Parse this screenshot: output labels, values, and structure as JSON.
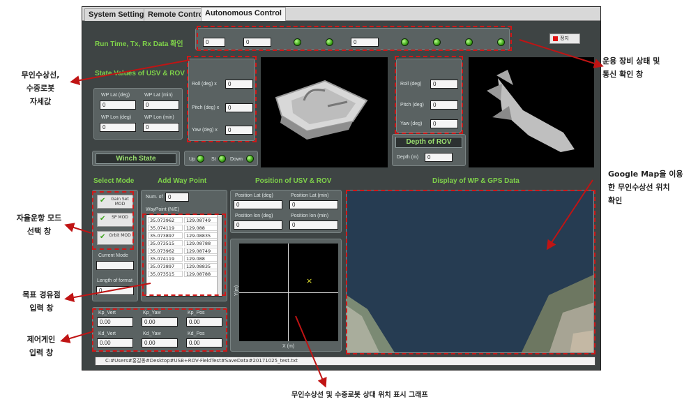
{
  "tabs": [
    "System Setting",
    "Remote Control",
    "Autonomous Control"
  ],
  "header": {
    "run_time_title": "Run Time, Tx, Rx Data 확인",
    "stop_label": "정지",
    "field_values": [
      "0",
      "0",
      "0"
    ]
  },
  "state": {
    "title": "State Values of USV & ROV",
    "usv_fields": [
      {
        "label": "WP Lat (deg)",
        "value": "0"
      },
      {
        "label": "WP Lat (min)",
        "value": "0"
      },
      {
        "label": "WP Lon (deg)",
        "value": "0"
      },
      {
        "label": "WP Lon (min)",
        "value": "0"
      }
    ],
    "usv_attitude": [
      {
        "label": "Roll (deg) x",
        "value": "0"
      },
      {
        "label": "Pitch (deg) x",
        "value": "0"
      },
      {
        "label": "Yaw (deg) x",
        "value": "0"
      }
    ],
    "rov_attitude": [
      {
        "label": "Roll (deg)",
        "value": "0"
      },
      {
        "label": "Pitch (deg)",
        "value": "0"
      },
      {
        "label": "Yaw (deg)",
        "value": "0"
      }
    ],
    "depth_title": "Depth of ROV",
    "depth_label": "Depth (m)",
    "depth_value": "0"
  },
  "winch": {
    "title": "Winch State",
    "labels": [
      "Up",
      "St",
      "Down"
    ]
  },
  "select_mode": {
    "title": "Select Mode",
    "buttons": [
      "Gain Set MOD",
      "SP MOD",
      "Orbit MOD"
    ],
    "current_mode_label": "Current Mode",
    "length_label": "Length of format",
    "length_value": "0"
  },
  "waypoint": {
    "title": "Add Way Point",
    "num_label": "Num. of",
    "num_value": "0",
    "list_label": "WayPoint (N/E)",
    "rows": [
      [
        "35.073962",
        "129.08749"
      ],
      [
        "35.074119",
        "129.088"
      ],
      [
        "35.073897",
        "129.08835"
      ],
      [
        "35.073515",
        "129.08788"
      ],
      [
        "35.073962",
        "129.08749"
      ],
      [
        "35.074119",
        "129.088"
      ],
      [
        "35.073897",
        "129.08835"
      ],
      [
        "35.073515",
        "129.08788"
      ]
    ]
  },
  "gains": [
    {
      "label": "Kp_Vert",
      "value": "0.00"
    },
    {
      "label": "Kp_Yaw",
      "value": "0.00"
    },
    {
      "label": "Kp_Pos",
      "value": "0.00"
    },
    {
      "label": "Kd_Vert",
      "value": "0.00"
    },
    {
      "label": "Kd_Yaw",
      "value": "0.00"
    },
    {
      "label": "Kd_Pos",
      "value": "0.00"
    }
  ],
  "position": {
    "title": "Position of USV & ROV",
    "fields": [
      {
        "label": "Position Lat (deg)",
        "value": "0"
      },
      {
        "label": "Position Lat (min)",
        "value": "0"
      },
      {
        "label": "Position lon (deg)",
        "value": "0"
      },
      {
        "label": "Position lon (min)",
        "value": "0"
      }
    ],
    "xlabel": "X (m)",
    "ylabel": "Y(m)"
  },
  "display": {
    "title": "Display of WP & GPS Data"
  },
  "statusbar_path": "C:#Users#홍길동#Desktop#USB+ROV-FieldTest#SaveData#20171025_test.txt",
  "annotations": {
    "top_right": [
      "운용 장비 상태 및",
      "통신 확인 창"
    ],
    "left_attitude": [
      "무인수상선,",
      "수중로봇",
      "자세값"
    ],
    "google_map": [
      "Google Map을 이용",
      "한 무인수상선 위치",
      "확인"
    ],
    "mode_select": [
      "자율운항 모드",
      "선택 창"
    ],
    "waypoint_input": [
      "목표 경유점",
      "입력 창"
    ],
    "gain_input": [
      "제어게인",
      "입력 창"
    ],
    "bottom": "무인수상선 및 수중로봇 상대 위치 표시 그래프"
  },
  "colors": {
    "panel_bg": "#3e4444",
    "title_green": "#7fd24a",
    "led_green": "#3da418",
    "annotation_red": "#c01414",
    "map_water": "#263c52"
  }
}
